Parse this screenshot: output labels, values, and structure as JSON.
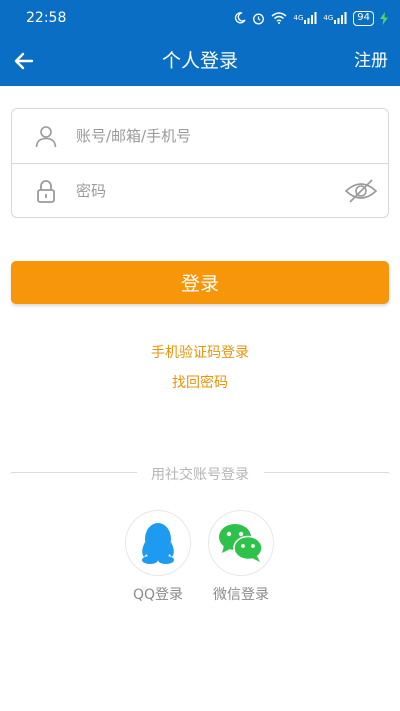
{
  "status_bar": {
    "time": "22:58",
    "network_1": "4G",
    "network_2": "4G",
    "battery": "94",
    "icons": [
      "moon-icon",
      "alarm-icon",
      "wifi-icon",
      "signal-icon",
      "signal-icon",
      "battery-icon",
      "charging-icon"
    ]
  },
  "app_bar": {
    "title": "个人登录",
    "register_label": "注册",
    "back_icon": "arrow-left-icon"
  },
  "form": {
    "account_placeholder": "账号/邮箱/手机号",
    "account_value": "",
    "password_placeholder": "密码",
    "password_value": "",
    "account_icon": "user-icon",
    "password_icon": "lock-icon",
    "visibility_icon": "eye-off-icon"
  },
  "login_button_label": "登录",
  "links": {
    "sms_login": "手机验证码登录",
    "recover_password": "找回密码"
  },
  "social": {
    "divider_text": "用社交账号登录",
    "qq_label": "QQ登录",
    "wechat_label": "微信登录"
  },
  "colors": {
    "primary": "#0a6fc4",
    "accent": "#f7960a",
    "link": "#e8940a",
    "qq": "#1d9bf0",
    "wechat": "#2fc24a"
  }
}
